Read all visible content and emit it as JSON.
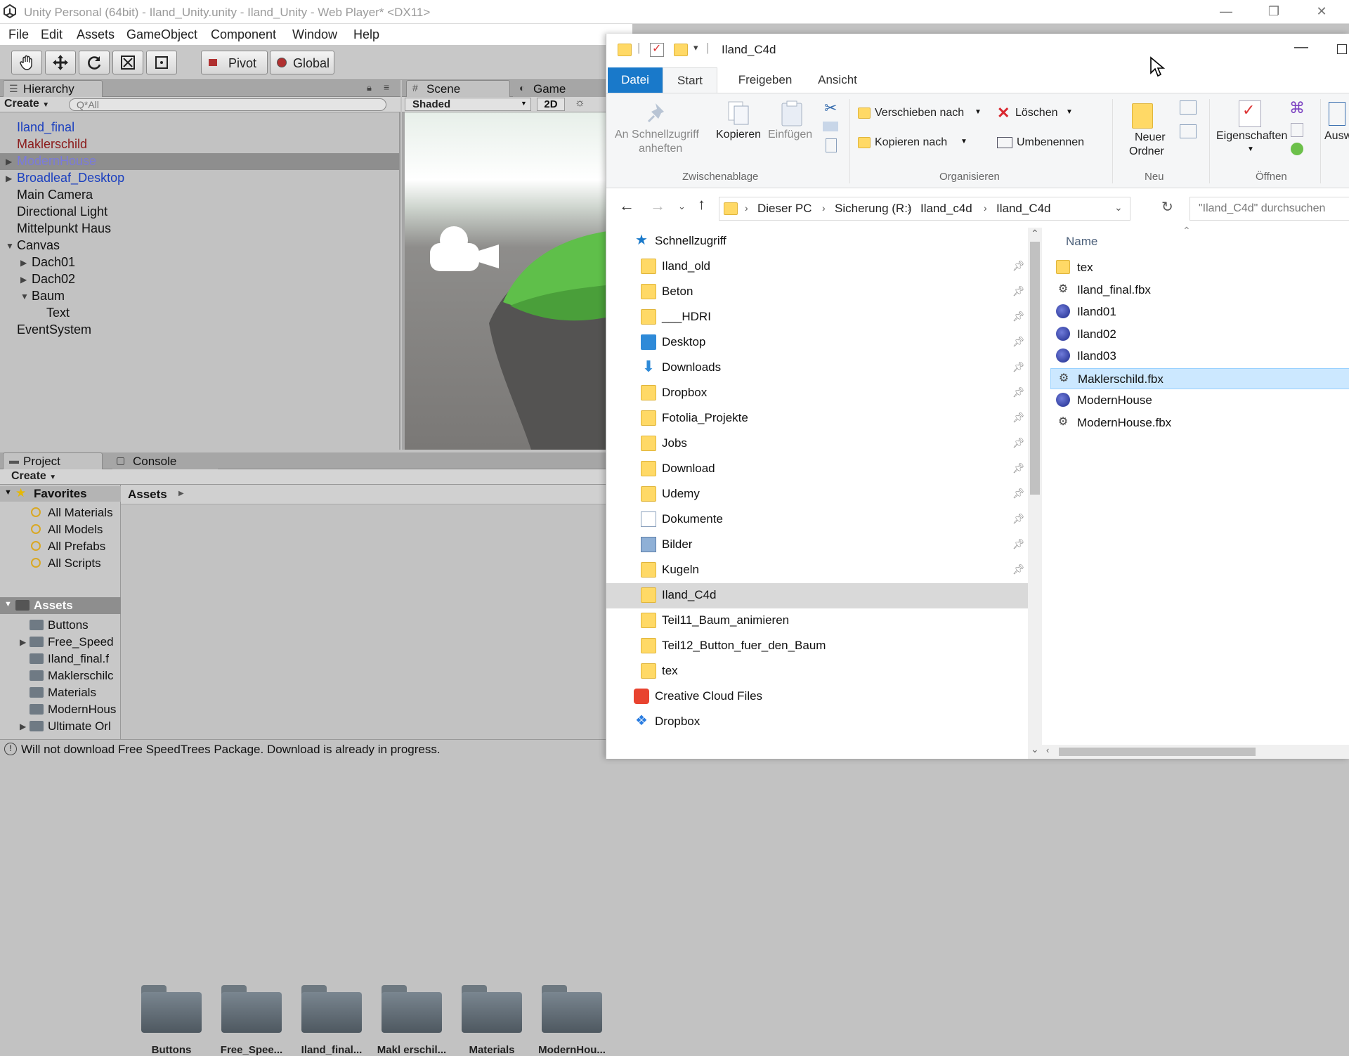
{
  "unity": {
    "title": "Unity Personal (64bit) - Iland_Unity.unity - Iland_Unity - Web Player* <DX11>",
    "window_controls": {
      "minimize": "—",
      "restore": "❐",
      "close": "✕"
    },
    "menu": [
      "File",
      "Edit",
      "Assets",
      "GameObject",
      "Component",
      "Window",
      "Help"
    ],
    "toolbar": {
      "pivot": "Pivot",
      "global": "Global"
    },
    "hierarchy": {
      "tab": "Hierarchy",
      "create": "Create",
      "search_placeholder": "Q*All",
      "items": [
        {
          "label": "Iland_final",
          "indent": 0,
          "expand": "",
          "color": "blue"
        },
        {
          "label": "Maklerschild",
          "indent": 0,
          "expand": "",
          "color": "red"
        },
        {
          "label": "ModernHouse",
          "indent": 0,
          "expand": "▶",
          "color": "sel"
        },
        {
          "label": "Broadleaf_Desktop",
          "indent": 0,
          "expand": "▶",
          "color": "blue"
        },
        {
          "label": "Main Camera",
          "indent": 0,
          "expand": "",
          "color": ""
        },
        {
          "label": "Directional Light",
          "indent": 0,
          "expand": "",
          "color": ""
        },
        {
          "label": "Mittelpunkt Haus",
          "indent": 0,
          "expand": "",
          "color": ""
        },
        {
          "label": "Canvas",
          "indent": 0,
          "expand": "▼",
          "color": ""
        },
        {
          "label": "Dach01",
          "indent": 1,
          "expand": "▶",
          "color": ""
        },
        {
          "label": "Dach02",
          "indent": 1,
          "expand": "▶",
          "color": ""
        },
        {
          "label": "Baum",
          "indent": 1,
          "expand": "▼",
          "color": ""
        },
        {
          "label": "Text",
          "indent": 2,
          "expand": "",
          "color": ""
        },
        {
          "label": "EventSystem",
          "indent": 0,
          "expand": "",
          "color": ""
        }
      ]
    },
    "scene": {
      "tab": "Scene",
      "game_tab": "Game",
      "shading": "Shaded",
      "mode_2d": "2D"
    },
    "project": {
      "tab": "Project",
      "console_tab": "Console",
      "create": "Create",
      "favorites_label": "Favorites",
      "favorites": [
        "All Materials",
        "All Models",
        "All Prefabs",
        "All Scripts"
      ],
      "assets_label": "Assets",
      "assets_tree": [
        {
          "label": "Buttons",
          "expand": ""
        },
        {
          "label": "Free_Speed",
          "expand": "▶"
        },
        {
          "label": "Iland_final.f",
          "expand": ""
        },
        {
          "label": "Maklerschilc",
          "expand": ""
        },
        {
          "label": "Materials",
          "expand": ""
        },
        {
          "label": "ModernHous",
          "expand": ""
        },
        {
          "label": "Ultimate Orl",
          "expand": "▶"
        }
      ],
      "breadcrumb": "Assets",
      "grid_items": [
        "Buttons",
        "Free_Spee...",
        "Iland_final...",
        "Makl erschil...",
        "Materials",
        "ModernHou..."
      ]
    },
    "status_message": "Will not download Free SpeedTrees Package. Download is already in progress."
  },
  "explorer": {
    "title": "Iland_C4d",
    "ribbon_tabs": [
      "Datei",
      "Start",
      "Freigeben",
      "Ansicht"
    ],
    "ribbon": {
      "pin_quick_access": [
        "An Schnellzugriff",
        "anheften"
      ],
      "copy": "Kopieren",
      "paste": "Einfügen",
      "clipboard_group": "Zwischenablage",
      "move_to": "Verschieben nach",
      "copy_to": "Kopieren nach",
      "delete": "Löschen",
      "rename": "Umbenennen",
      "organize_group": "Organisieren",
      "new_folder": [
        "Neuer",
        "Ordner"
      ],
      "new_group": "Neu",
      "properties": "Eigenschaften",
      "open_group": "Öffnen",
      "select_partial": "Ausw"
    },
    "address": {
      "crumbs": [
        "Dieser PC",
        "Sicherung (R:)",
        "Iland_c4d",
        "Iland_C4d"
      ],
      "search_placeholder": "\"Iland_C4d\" durchsuchen"
    },
    "nav": [
      {
        "label": "Schnellzugriff",
        "icon": "star",
        "pin": false,
        "indent": 0
      },
      {
        "label": "Iland_old",
        "icon": "folder",
        "pin": true,
        "indent": 1
      },
      {
        "label": "Beton",
        "icon": "folder",
        "pin": true,
        "indent": 1
      },
      {
        "label": "___HDRI",
        "icon": "folder",
        "pin": true,
        "indent": 1
      },
      {
        "label": "Desktop",
        "icon": "desktop",
        "pin": true,
        "indent": 1
      },
      {
        "label": "Downloads",
        "icon": "download",
        "pin": true,
        "indent": 1
      },
      {
        "label": "Dropbox",
        "icon": "folder",
        "pin": true,
        "indent": 1
      },
      {
        "label": "Fotolia_Projekte",
        "icon": "folder",
        "pin": true,
        "indent": 1
      },
      {
        "label": "Jobs",
        "icon": "folder",
        "pin": true,
        "indent": 1
      },
      {
        "label": "Download",
        "icon": "folder",
        "pin": true,
        "indent": 1
      },
      {
        "label": "Udemy",
        "icon": "folder",
        "pin": true,
        "indent": 1
      },
      {
        "label": "Dokumente",
        "icon": "document",
        "pin": true,
        "indent": 1
      },
      {
        "label": "Bilder",
        "icon": "pictures",
        "pin": true,
        "indent": 1
      },
      {
        "label": "Kugeln",
        "icon": "folder",
        "pin": true,
        "indent": 1
      },
      {
        "label": "Iland_C4d",
        "icon": "folder",
        "pin": false,
        "indent": 1,
        "selected": true
      },
      {
        "label": "Teil11_Baum_animieren",
        "icon": "folder",
        "pin": false,
        "indent": 1
      },
      {
        "label": "Teil12_Button_fuer_den_Baum",
        "icon": "folder",
        "pin": false,
        "indent": 1
      },
      {
        "label": "tex",
        "icon": "folder",
        "pin": false,
        "indent": 1
      },
      {
        "label": "Creative Cloud Files",
        "icon": "cc",
        "pin": false,
        "indent": 0
      },
      {
        "label": "Dropbox",
        "icon": "dropbox",
        "pin": false,
        "indent": 0
      }
    ],
    "files_header": "Name",
    "files": [
      {
        "label": "tex",
        "icon": "folder"
      },
      {
        "label": "Iland_final.fbx",
        "icon": "fbx"
      },
      {
        "label": "Iland01",
        "icon": "c4d"
      },
      {
        "label": "Iland02",
        "icon": "c4d"
      },
      {
        "label": "Iland03",
        "icon": "c4d"
      },
      {
        "label": "Maklerschild.fbx",
        "icon": "fbx",
        "selected": true
      },
      {
        "label": "ModernHouse",
        "icon": "c4d"
      },
      {
        "label": "ModernHouse.fbx",
        "icon": "fbx"
      }
    ],
    "colors": {
      "accent": "#1979ca",
      "selected_bg": "#cce8ff",
      "folder": "#ffd966"
    }
  }
}
